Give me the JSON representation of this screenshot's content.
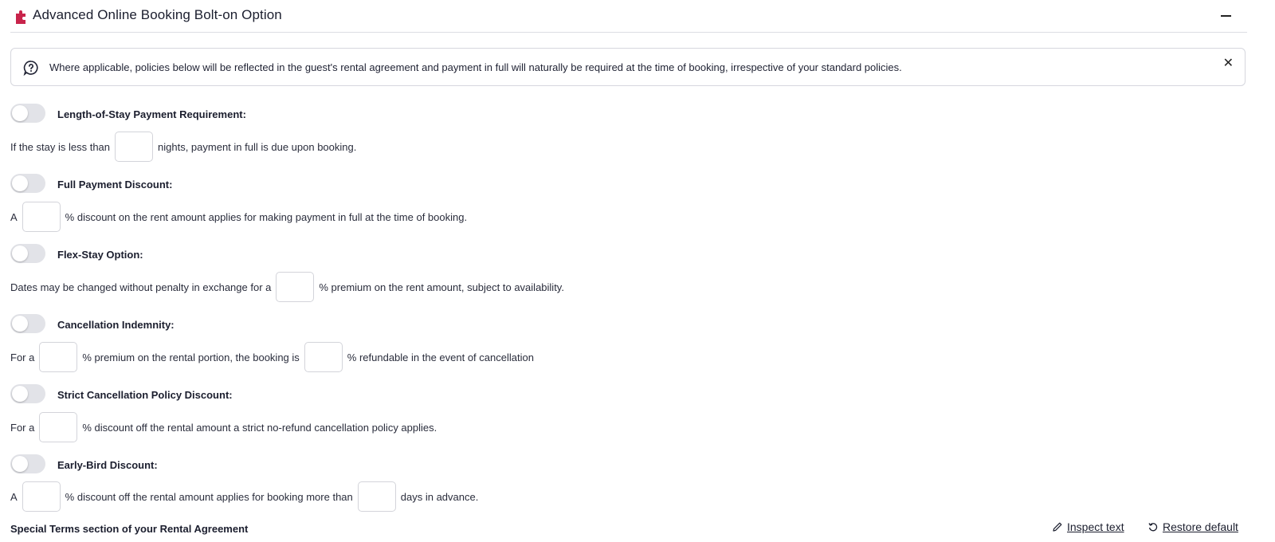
{
  "header": {
    "title": "Advanced Online Booking Bolt-on Option",
    "accent_color": "#c8244b"
  },
  "notice": {
    "text": "Where applicable, policies below will be reflected in the guest's rental agreement and payment in full will naturally be required at the time of booking, irrespective of your standard policies."
  },
  "options": {
    "length_of_stay": {
      "label": "Length-of-Stay Payment Requirement:",
      "enabled": false,
      "text_1": "If the stay is less than",
      "text_2": "nights, payment in full is due upon booking."
    },
    "full_payment": {
      "label": "Full Payment Discount:",
      "enabled": false,
      "text_1": "A",
      "text_2": "% discount on the rent amount applies for making payment in full at the time of booking."
    },
    "flex_stay": {
      "label": "Flex-Stay Option:",
      "enabled": false,
      "text_1": "Dates may be changed without penalty in exchange for a",
      "text_2": "% premium on the rent amount, subject to availability."
    },
    "cancellation_indemnity": {
      "label": "Cancellation Indemnity:",
      "enabled": false,
      "text_1": "For a",
      "text_2": "% premium on the rental portion, the booking is",
      "text_3": "% refundable in the event of cancellation"
    },
    "strict_cancellation": {
      "label": "Strict Cancellation Policy Discount:",
      "enabled": false,
      "text_1": "For a",
      "text_2": "% discount off the rental amount a strict no-refund cancellation policy applies."
    },
    "early_bird": {
      "label": "Early-Bird Discount:",
      "enabled": false,
      "text_1": "A",
      "text_2": "% discount off the rental amount applies for booking more than",
      "text_3": "days in advance."
    }
  },
  "footer": {
    "section_label": "Special Terms section of your Rental Agreement",
    "inspect_label": "Inspect text",
    "restore_label": "Restore default"
  }
}
